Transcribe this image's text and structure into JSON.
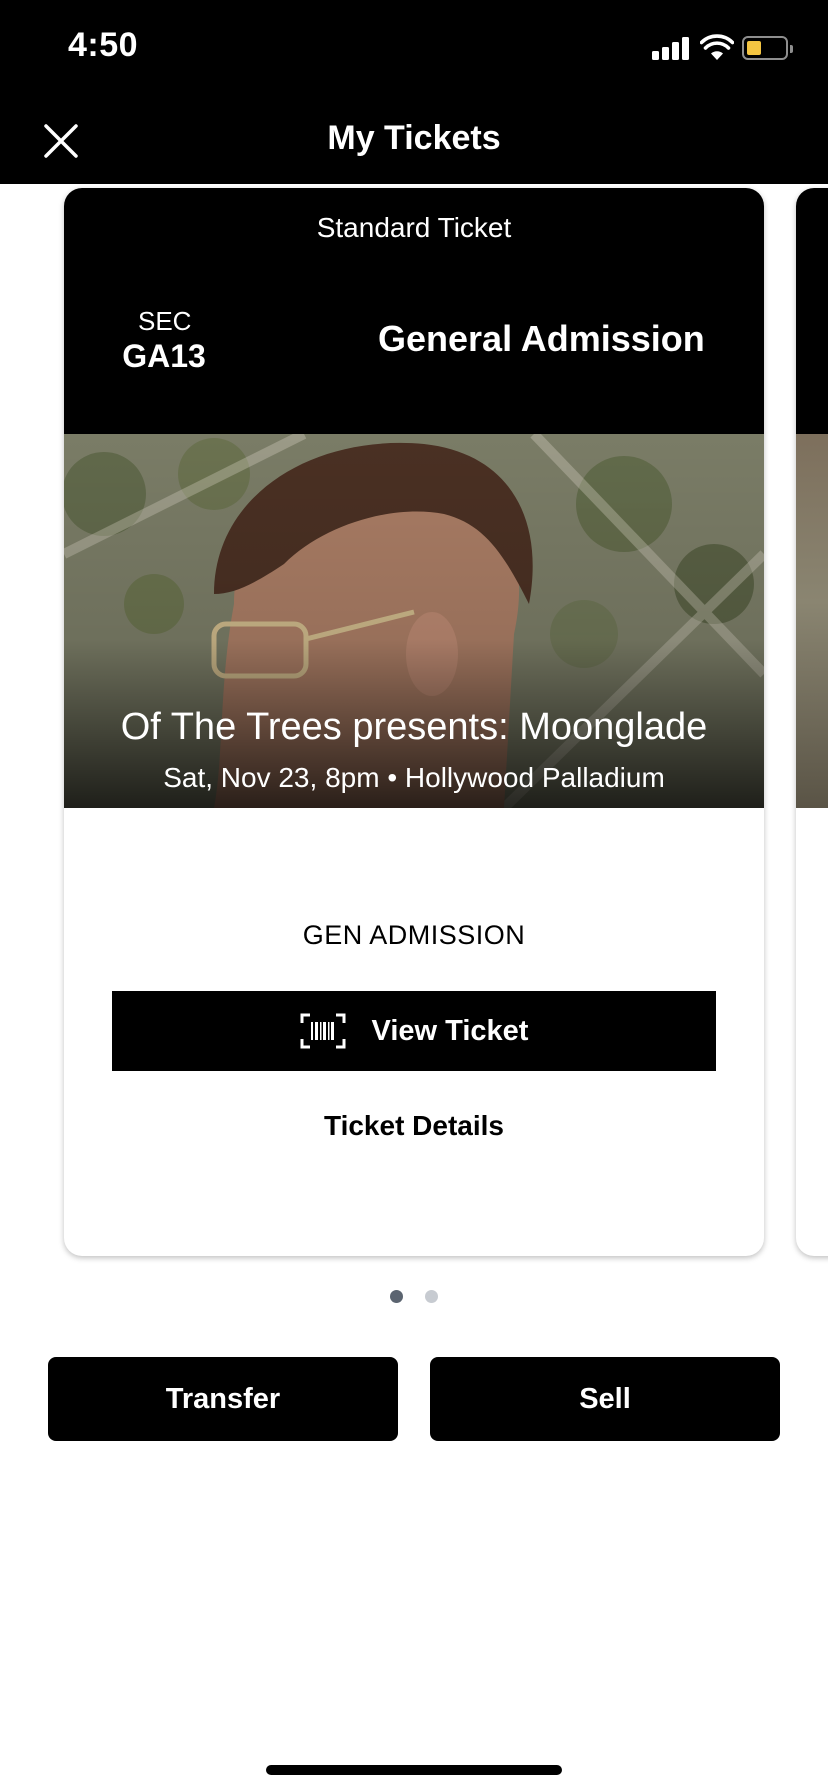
{
  "status_bar": {
    "time": "4:50",
    "battery_color": "#f4c542"
  },
  "nav": {
    "title": "My Tickets",
    "close_icon": "close-icon"
  },
  "ticket": {
    "type": "Standard Ticket",
    "section_label": "SEC",
    "section_value": "GA13",
    "admission": "General Admission",
    "event_title": "Of The Trees presents: Moonglade",
    "event_meta": "Sat, Nov 23, 8pm • Hollywood Palladium",
    "admission_code": "GEN ADMISSION",
    "view_ticket_label": "View Ticket",
    "view_ticket_icon": "barcode-icon",
    "details_label": "Ticket Details"
  },
  "pagination": {
    "count": 2,
    "active_index": 0
  },
  "actions": {
    "transfer_label": "Transfer",
    "sell_label": "Sell"
  }
}
